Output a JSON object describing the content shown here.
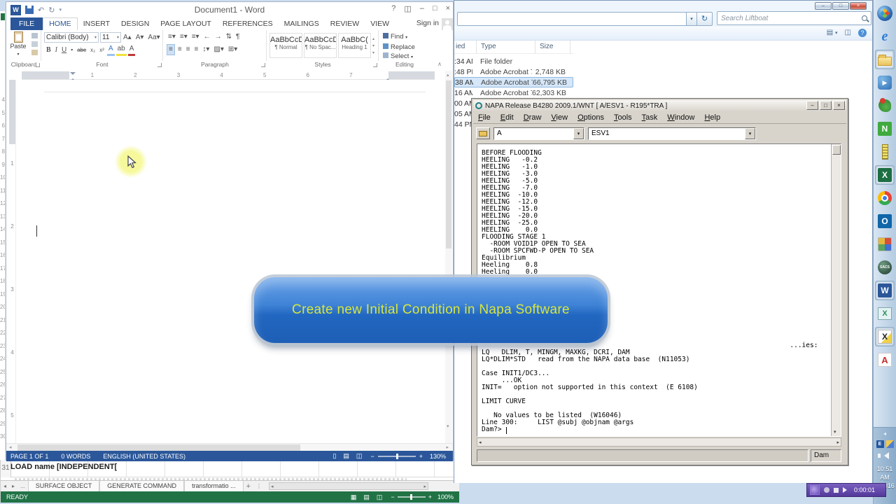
{
  "colors": {
    "word_accent": "#2b579a",
    "excel_green": "#217346",
    "banner_blue": "#2a6fc8",
    "banner_text": "#d6e63e",
    "selection_blue": "#d5e7f9"
  },
  "word": {
    "title": "Document1 - Word",
    "qat": {
      "logo": "W",
      "undo": "↶",
      "redo": "↻",
      "customize": "▾"
    },
    "controls": {
      "help": "?",
      "ribbon_options": "◫",
      "minimize": "–",
      "restore": "□",
      "close": "×"
    },
    "tabs": [
      {
        "label": "FILE",
        "cls": "file"
      },
      {
        "label": "HOME",
        "cls": "active"
      },
      {
        "label": "INSERT"
      },
      {
        "label": "DESIGN"
      },
      {
        "label": "PAGE LAYOUT"
      },
      {
        "label": "REFERENCES"
      },
      {
        "label": "MAILINGS"
      },
      {
        "label": "REVIEW"
      },
      {
        "label": "VIEW"
      }
    ],
    "sign_in": "Sign in",
    "ribbon": {
      "paste": "Paste",
      "paste_arrow": "▾",
      "font_name": "Calibri (Body)",
      "font_size": "11",
      "combo_arrow": "▾",
      "grow_font": "A▴",
      "shrink_font": "A▾",
      "change_case": "Aa▾",
      "bold": "B",
      "italic": "I",
      "underline": "U",
      "underline_arrow": "▾",
      "strikethrough": "abc",
      "subscript": "x₂",
      "superscript": "x²",
      "text_effects": "A",
      "highlight": "ab",
      "highlight_arrow": "▾",
      "font_color": "A",
      "font_color_arrow": "▾",
      "bullets": "≡▾",
      "numbering": "≡▾",
      "multilevel": "≡▾",
      "outdent": "←",
      "indent": "→",
      "sort": "⇅",
      "pilcrow": "¶",
      "align_left": "≡",
      "align_center": "≡",
      "align_right": "≡",
      "justify": "≡",
      "line_spacing": "↕▾",
      "shading": "▨▾",
      "borders": "⊞▾",
      "styles": [
        {
          "preview": "AaBbCcDc",
          "label": "¶ Normal",
          "cls": "sel"
        },
        {
          "preview": "AaBbCcDc",
          "label": "¶ No Spac..."
        },
        {
          "preview": "AaBbC(",
          "label": "Heading 1",
          "cls": "head"
        }
      ],
      "styles_up": "▴",
      "styles_down": "▾",
      "styles_more": "▾",
      "find": "Find",
      "find_arrow": "▾",
      "replace": "Replace",
      "select": "Select",
      "select_arrow": "▾",
      "groups": [
        "Clipboard",
        "Font",
        "Paragraph",
        "Styles",
        "Editing"
      ],
      "collapse": "∧"
    },
    "hruler_numbers": [
      "1",
      "2",
      "3",
      "4",
      "5",
      "6",
      "7"
    ],
    "vruler_numbers": [
      "1",
      "2",
      "3",
      "4",
      "5"
    ],
    "scroll": {
      "up": "▴",
      "down": "▾",
      "left": "◂",
      "right": "▸"
    },
    "status": {
      "page": "PAGE 1 OF 1",
      "words": "0 WORDS",
      "language": "ENGLISH (UNITED STATES)",
      "view_read": "▯",
      "view_print": "▤",
      "view_web": "◫",
      "zoom_out": "−",
      "zoom_in": "+",
      "zoom_level": "130%"
    }
  },
  "explorer": {
    "controls": {
      "minimize": "–",
      "restore": "□",
      "close": "×"
    },
    "address_arrow": "▾",
    "refresh": "↻",
    "search_placeholder": "Search Liftboat",
    "toolbar": {
      "views": "▤",
      "views_arrow": "▾",
      "preview": "◫",
      "help": "?"
    },
    "columns": {
      "modified": "ied",
      "type": "Type",
      "size": "Size"
    },
    "rows": [
      {
        "time": ":34 AM",
        "type": "File folder",
        "size": ""
      },
      {
        "time": ":48 PM",
        "type": "Adobe Acrobat 7....",
        "size": "2,748 KB"
      },
      {
        "time": "38 AM",
        "type": "Adobe Acrobat 7....",
        "size": "66,795 KB",
        "cls": "selected"
      },
      {
        "time": "16 AM",
        "type": "Adobe Acrobat 7....",
        "size": "62,303 KB"
      },
      {
        "time": "00 AM",
        "type": "",
        "size": ""
      },
      {
        "time": "05 AM",
        "type": "",
        "size": ""
      },
      {
        "time": "44 PM",
        "type": "",
        "size": ""
      }
    ]
  },
  "napa": {
    "title": "NAPA Release B4280 2009.1/WNT [ A/ESV1 - R195*TRA ]",
    "controls": {
      "minimize": "–",
      "restore": "□",
      "close": "×"
    },
    "menus": [
      "File",
      "Edit",
      "Draw",
      "View",
      "Options",
      "Tools",
      "Task",
      "Window",
      "Help"
    ],
    "combo_project": "A",
    "combo_version": "ESV1",
    "combo_arrow": "▾",
    "console_top": "BEFORE FLOODING\nHEELING   -0.2\nHEELING   -1.0\nHEELING   -3.0\nHEELING   -5.0\nHEELING   -7.0\nHEELING  -10.0\nHEELING  -12.0\nHEELING  -15.0\nHEELING  -20.0\nHEELING  -25.0\nHEELING    0.0\nFLOODING STAGE 1\n  -ROOM VOID1P OPEN TO SEA\n  -ROOM SPCFWD-P OPEN TO SEA\nEquilibrium\nHeeling    0.8\nHeeling    0.0",
    "console_bottom": "                                                                             ...ies:\nLQ   DLIM, T, MINGM, MAXKG, DCRI, DAM\nLQ*DLIM*STD   read from the NAPA data base  (N11053)\n\nCase INIT1/DC3...\n     ...OK\nINIT=   option not supported in this context  (E 6108)\n\nLIMIT CURVE\n\n   No values to be listed  (W16046)\nLine 300:     LIST @subj @objnam @args\nDam?>",
    "status_mode": "Dam",
    "scroll": {
      "up": "▴",
      "down": "▾",
      "left": "◂",
      "right": "▸"
    }
  },
  "banner": {
    "text": "Create new Initial Condition in Napa Software"
  },
  "excel": {
    "row_number": "31",
    "cell_text": "LOAD name [INDEPENDENT[",
    "row_strip": "4\n5\n6\n7\n8\n9\n10\n11\n12\n13\n14\n15\n16\n17\n18\n19\n20\n21\n22\n23\n24\n25\n26\n27\n28\n29\n30",
    "nav_left": "◂",
    "nav_right": "▸",
    "nav_more": "...",
    "sheet_tabs": [
      "SURFACE OBJECT",
      "GENERATE COMMAND",
      "transformatio ..."
    ],
    "add_sheet": "+",
    "tab_menu": "⋮",
    "scroll_left": "◂",
    "scroll_right": "▸",
    "status": "READY",
    "view_normal": "▦",
    "view_page": "▤",
    "view_break": "◫",
    "zoom_out": "−",
    "zoom_in": "+",
    "zoom_level": "100%"
  },
  "taskbar": {
    "icons": [
      {
        "name": "start-menu",
        "glyph": ""
      },
      {
        "name": "internet-explorer",
        "glyph": "e"
      },
      {
        "name": "file-explorer",
        "glyph": ""
      },
      {
        "name": "media-player",
        "glyph": "▶"
      },
      {
        "name": "parrot-app",
        "glyph": ""
      },
      {
        "name": "notes-app",
        "glyph": "N"
      },
      {
        "name": "ruler-app",
        "glyph": ""
      },
      {
        "name": "excel",
        "glyph": "X"
      },
      {
        "name": "chrome",
        "glyph": ""
      },
      {
        "name": "outlook",
        "glyph": "O"
      },
      {
        "name": "tiles-app",
        "glyph": ""
      },
      {
        "name": "sacs-app",
        "glyph": "SACS"
      },
      {
        "name": "word",
        "glyph": "W"
      },
      {
        "name": "whiteboard-app",
        "glyph": "X"
      },
      {
        "name": "cad-app",
        "glyph": "X"
      },
      {
        "name": "acrobat",
        "glyph": "A"
      }
    ],
    "tray_expand": "◂",
    "tray_icon_e": "E",
    "clock_time": "10:51 AM",
    "clock_date": "4/2016"
  },
  "recorder": {
    "time": "0:00:01"
  }
}
